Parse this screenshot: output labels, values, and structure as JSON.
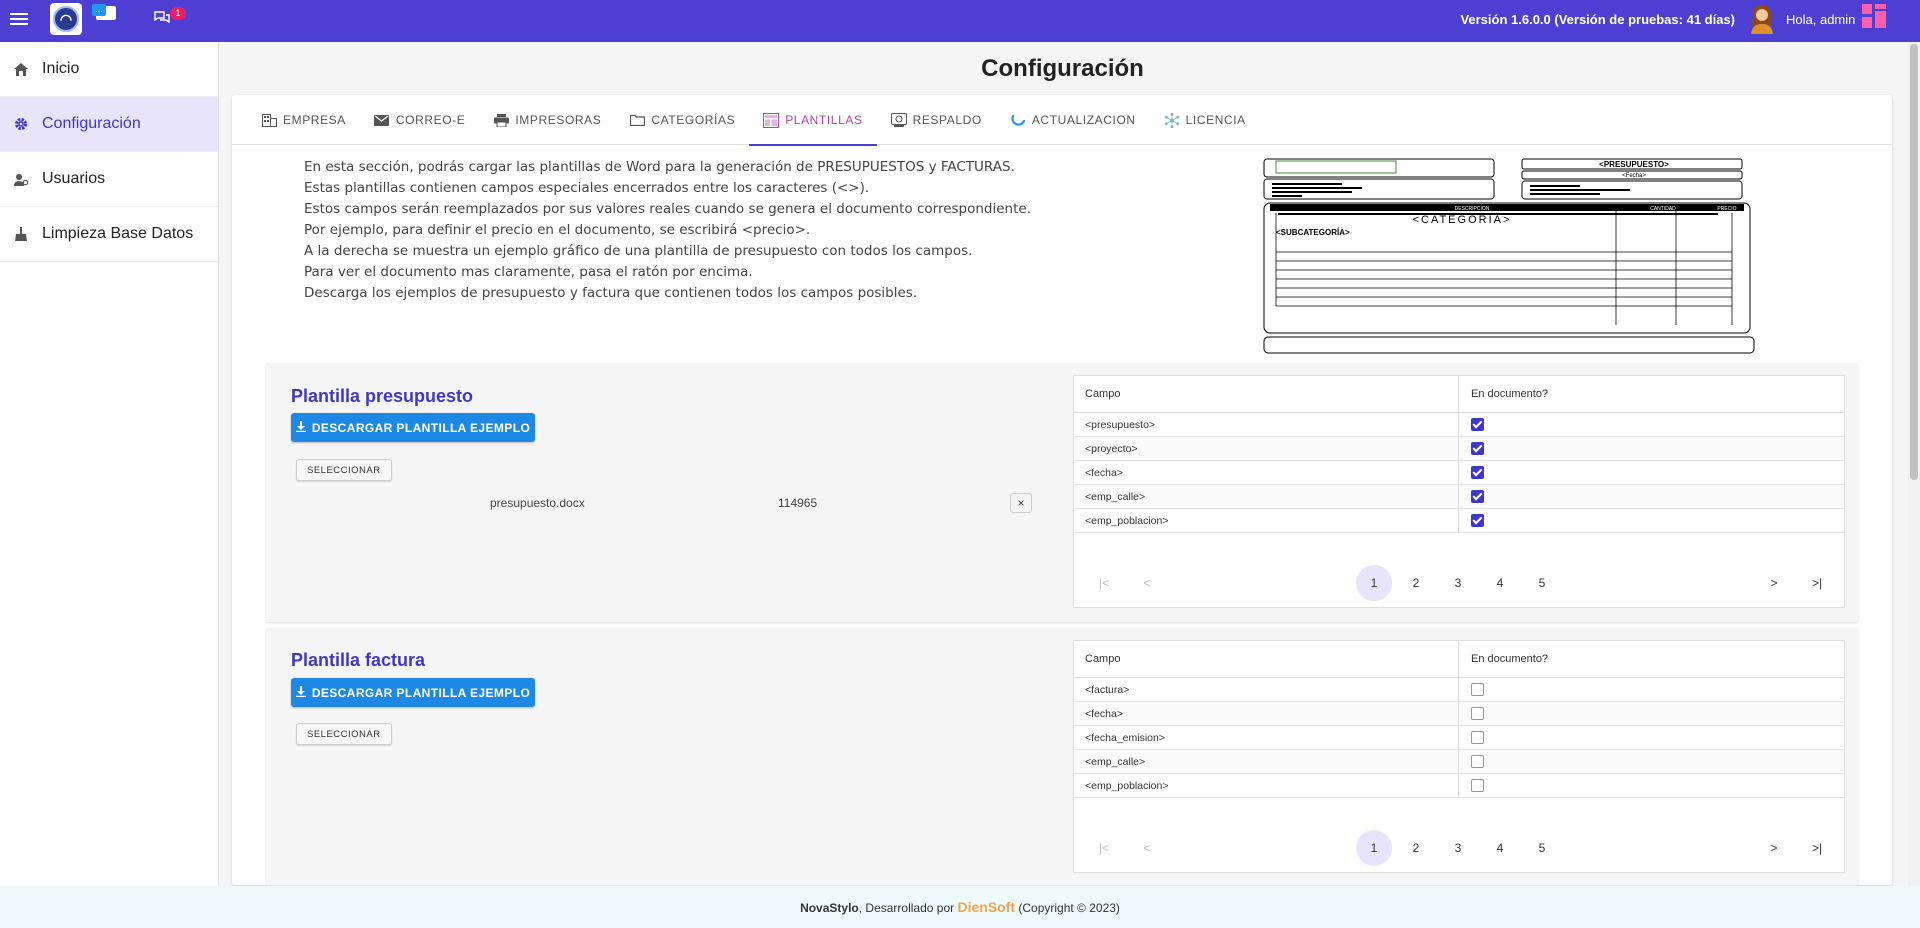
{
  "topbar": {
    "mail_chip": "...",
    "chat_badge": "1",
    "version": "Versión 1.6.0.0 (Versión de pruebas: 41 días)",
    "greeting": "Hola, admin"
  },
  "sidebar": {
    "items": [
      {
        "label": "Inicio",
        "icon": "home-icon"
      },
      {
        "label": "Configuración",
        "icon": "gear-icon",
        "active": true
      },
      {
        "label": "Usuarios",
        "icon": "users-icon"
      },
      {
        "label": "Limpieza Base Datos",
        "icon": "broom-icon"
      }
    ]
  },
  "page": {
    "title": "Configuración"
  },
  "tabs": [
    {
      "label": "EMPRESA",
      "icon": "building-icon"
    },
    {
      "label": "CORREO-E",
      "icon": "mail-icon"
    },
    {
      "label": "IMPRESORAS",
      "icon": "printer-icon"
    },
    {
      "label": "CATEGORÍAS",
      "icon": "folder-icon"
    },
    {
      "label": "PLANTILLAS",
      "icon": "template-icon",
      "active": true
    },
    {
      "label": "RESPALDO",
      "icon": "backup-icon"
    },
    {
      "label": "ACTUALIZACION",
      "icon": "update-icon"
    },
    {
      "label": "LICENCIA",
      "icon": "license-icon"
    }
  ],
  "intro": [
    "En esta sección, podrás cargar las plantillas de Word para la generación de PRESUPUESTOS y FACTURAS.",
    "Estas plantillas contienen campos especiales encerrados entre los caracteres (<>).",
    "Estos campos serán reemplazados por sus valores reales cuando se genera el documento correspondiente.",
    "Por ejemplo, para definir el precio en el documento, se escribirá <precio>.",
    "A la derecha se muestra un ejemplo gráfico de una plantilla de presupuesto con todos los campos.",
    "Para ver el documento mas claramente, pasa el ratón por encima.",
    "Descarga los ejemplos de presupuesto y factura que contienen todos los campos posibles."
  ],
  "preview": {
    "presupuesto_label": "<PRESUPUESTO>",
    "fecha_label": "<Fecha>",
    "categoria_label": "<CATEGORÍA>",
    "subcategoria_label": "<SUBCATEGORÍA>",
    "descripcion_label": "DESCRIPCION",
    "cantidad_label": "CANTIDAD",
    "precio_label": "PRECIO"
  },
  "table_headers": {
    "campo": "Campo",
    "en_documento": "En documento?"
  },
  "presupuesto": {
    "title": "Plantilla presupuesto",
    "download_label": "DESCARGAR PLANTILLA EJEMPLO",
    "select_label": "SELECCIONAR",
    "file_name": "presupuesto.docx",
    "file_size": "114965",
    "remove_label": "×",
    "rows": [
      {
        "campo": "<presupuesto>",
        "checked": true
      },
      {
        "campo": "<proyecto>",
        "checked": true
      },
      {
        "campo": "<fecha>",
        "checked": true
      },
      {
        "campo": "<emp_calle>",
        "checked": true
      },
      {
        "campo": "<emp_poblacion>",
        "checked": true
      }
    ],
    "pages": [
      "1",
      "2",
      "3",
      "4",
      "5"
    ],
    "current_page": "1"
  },
  "factura": {
    "title": "Plantilla factura",
    "download_label": "DESCARGAR PLANTILLA EJEMPLO",
    "select_label": "SELECCIONAR",
    "rows": [
      {
        "campo": "<factura>",
        "checked": false
      },
      {
        "campo": "<fecha>",
        "checked": false
      },
      {
        "campo": "<fecha_emision>",
        "checked": false
      },
      {
        "campo": "<emp_calle>",
        "checked": false
      },
      {
        "campo": "<emp_poblacion>",
        "checked": false
      }
    ],
    "pages": [
      "1",
      "2",
      "3",
      "4",
      "5"
    ],
    "current_page": "1"
  },
  "pager_glyphs": {
    "first": "|<",
    "prev": "<",
    "next": ">",
    "last": ">|"
  },
  "footer": {
    "app": "NovaStylo",
    "middle": ", Desarrollado por ",
    "brand": "DienSoft",
    "copyright": " (Copyright © 2023)"
  },
  "colors": {
    "topbar": "#4c3fd1",
    "accent": "#3f37c9",
    "active_tab": "#b73fb6",
    "download_button": "#1e88e5",
    "brand": "#f0a54a"
  }
}
